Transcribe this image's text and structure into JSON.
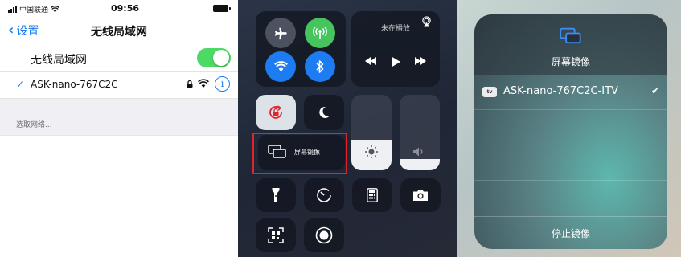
{
  "settings": {
    "status": {
      "carrier": "中国联通",
      "time": "09:56"
    },
    "nav": {
      "back_label": "设置",
      "title": "无线局域网"
    },
    "wifi_toggle": {
      "label": "无线局域网",
      "on": true,
      "color": "#4cd964"
    },
    "connected_network": {
      "name": "ASK-nano-767C2C",
      "info_icon": "i"
    },
    "section_header": "选取网络..."
  },
  "control_center": {
    "now_playing_label": "未在播放",
    "screen_mirroring_label": "屏幕镜像",
    "brightness_level": 0.4,
    "volume_level": 0.15,
    "highlight_color": "#e0242b",
    "icons": [
      "airplane-icon",
      "cellular-icon",
      "wifi-icon",
      "bluetooth-icon",
      "rotation-lock-icon",
      "moon-icon",
      "flashlight-icon",
      "timer-icon",
      "calculator-icon",
      "camera-icon",
      "qr-scanner-icon",
      "screen-record-icon"
    ]
  },
  "mirroring": {
    "title": "屏幕镜像",
    "device_badge": "tv",
    "device_name": "ASK-nano-767C2C-ITV",
    "selected_mark": "✔",
    "stop_label": "停止镜像"
  }
}
